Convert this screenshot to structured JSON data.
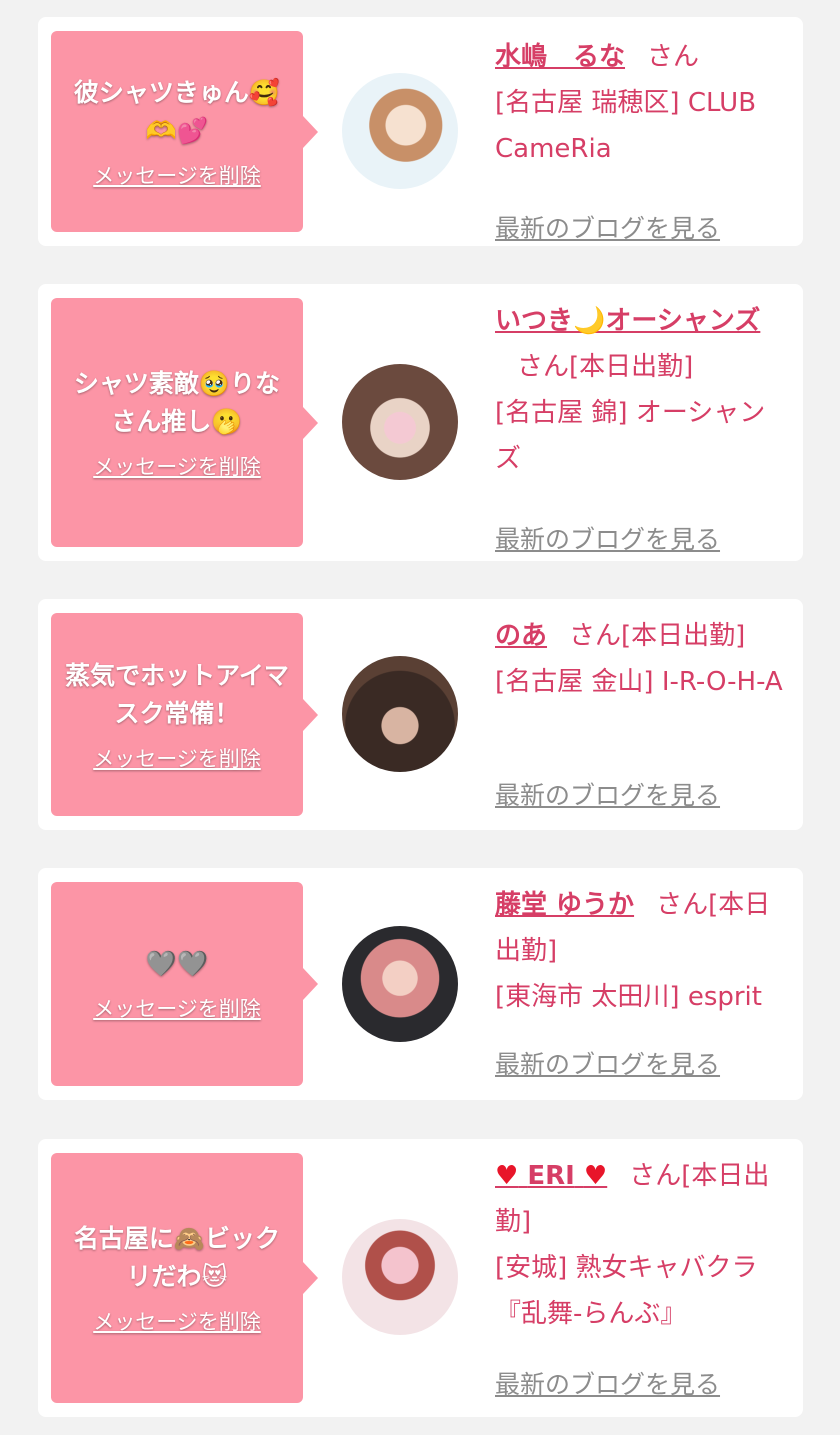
{
  "common": {
    "delete_label": "メッセージを削除",
    "blog_label": "最新のブログを見る"
  },
  "cards": [
    {
      "message": "彼シャツきゅん🥰🫶💕",
      "name": "水嶋　るな",
      "san": "さん",
      "status": "",
      "shop": "[名古屋 瑞穂区] CLUB CameRia"
    },
    {
      "message": "シャツ素敵🥹りなさん推し🫢",
      "name": "いつき🌙オーシャンズ",
      "san": "さん",
      "status": "[本日出勤]",
      "shop": "[名古屋 錦] オーシャンズ"
    },
    {
      "message": "蒸気でホットアイマスク常備！",
      "name": "のあ",
      "san": "さん",
      "status": "[本日出勤]",
      "shop": "[名古屋 金山] I-R-O-H-A"
    },
    {
      "message": "🩶🩶",
      "name": "藤堂 ゆうか",
      "san": "さん",
      "status": "[本日出勤]",
      "shop": "[東海市 太田川] esprit"
    },
    {
      "message": "名古屋に🙈ビックリだわ😻",
      "name_heart_left": "♥",
      "name": "ERI",
      "name_heart_right": "♥",
      "san": "さん",
      "status": "[本日出勤]",
      "shop": "[安城] 熟女キャバクラ『乱舞-らんぶ』"
    }
  ],
  "colors": {
    "bubble": "#fc95a6",
    "link": "#d63e66",
    "muted": "#8c8c8c",
    "background": "#f2f2f2"
  }
}
